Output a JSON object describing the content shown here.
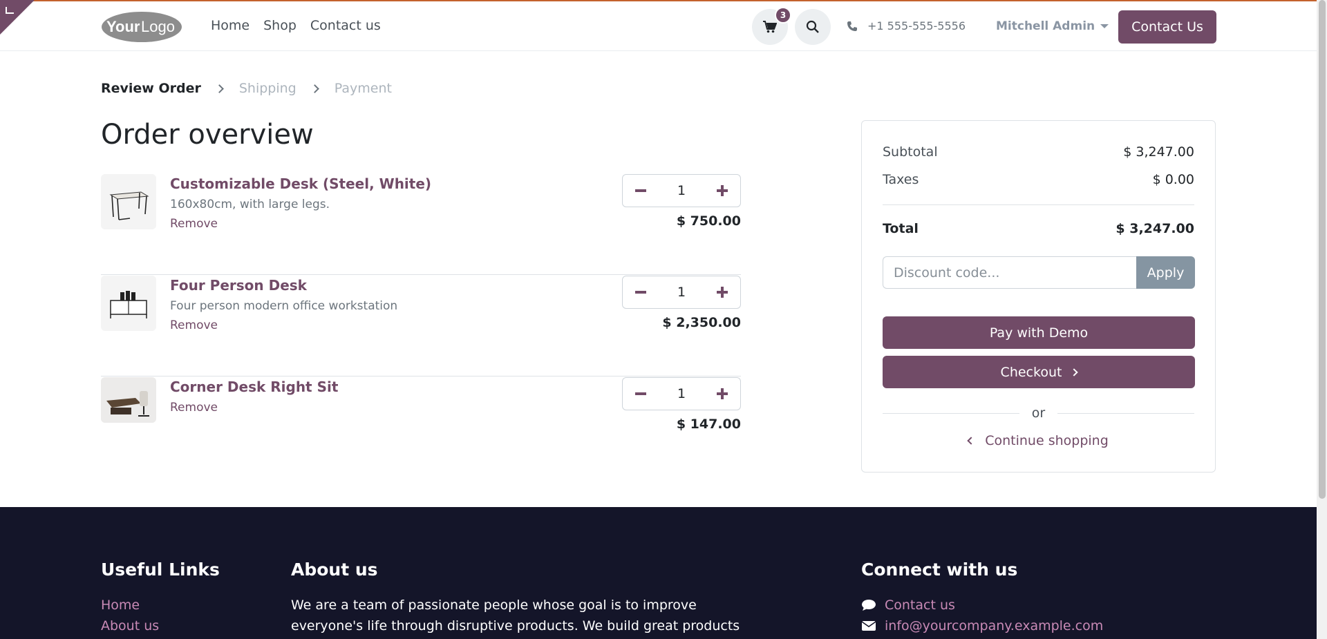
{
  "header": {
    "logo_text": "YourLogo",
    "nav": [
      "Home",
      "Shop",
      "Contact us"
    ],
    "cart_count": "3",
    "phone": "+1 555-555-5556",
    "user": "Mitchell Admin",
    "contact_button": "Contact Us"
  },
  "steps": [
    "Review Order",
    "Shipping",
    "Payment"
  ],
  "page_title": "Order overview",
  "order_lines": [
    {
      "name": "Customizable Desk (Steel, White)",
      "description": "160x80cm, with large legs.",
      "remove": "Remove",
      "qty": "1",
      "price": "$ 750.00"
    },
    {
      "name": "Four Person Desk",
      "description": "Four person modern office workstation",
      "remove": "Remove",
      "qty": "1",
      "price": "$ 2,350.00"
    },
    {
      "name": "Corner Desk Right Sit",
      "description": "",
      "remove": "Remove",
      "qty": "1",
      "price": "$ 147.00"
    }
  ],
  "summary": {
    "subtotal_label": "Subtotal",
    "subtotal": "$ 3,247.00",
    "taxes_label": "Taxes",
    "taxes": "$ 0.00",
    "total_label": "Total",
    "total": "$ 3,247.00",
    "discount_placeholder": "Discount code...",
    "apply": "Apply",
    "pay_demo": "Pay with Demo",
    "checkout": "Checkout",
    "or": "or",
    "continue": "Continue shopping"
  },
  "footer": {
    "useful_links_title": "Useful Links",
    "useful_links": [
      "Home",
      "About us"
    ],
    "about_title": "About us",
    "about_text": "We are a team of passionate people whose goal is to improve everyone's life through disruptive products. We build great products to",
    "connect_title": "Connect with us",
    "connect_links": [
      "Contact us",
      "info@yourcompany.example.com"
    ]
  },
  "colors": {
    "brand": "#714b67",
    "footer_bg": "#141529",
    "apply_bg": "#8595a2"
  }
}
